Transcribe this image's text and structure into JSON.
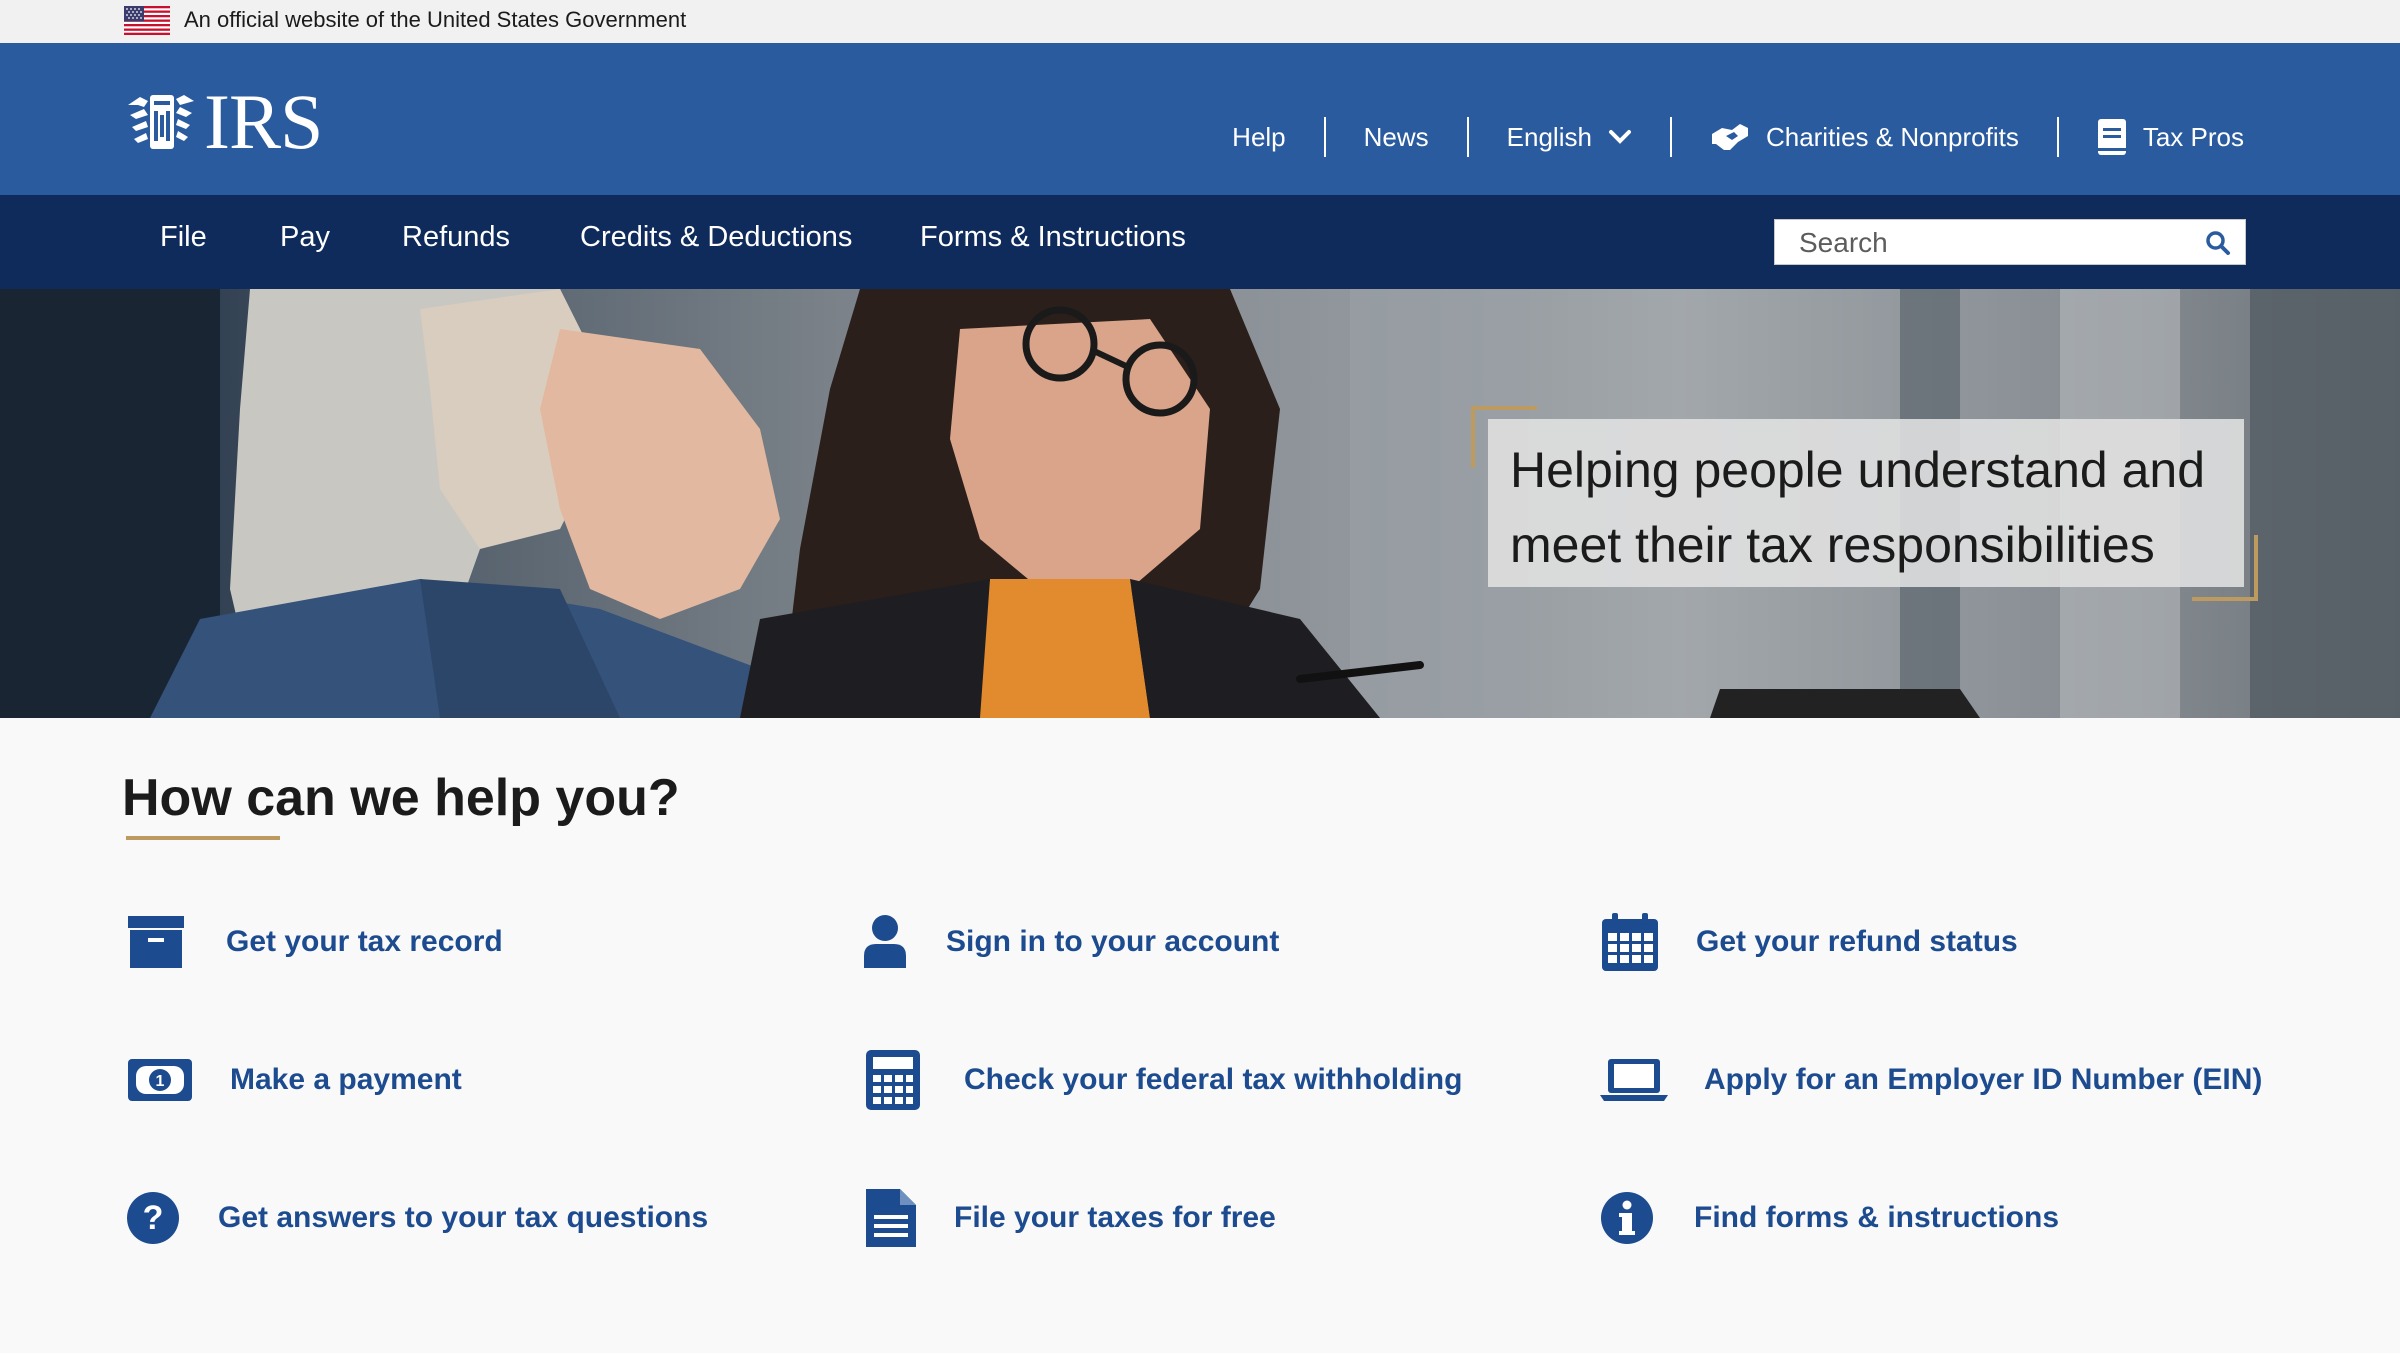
{
  "gov_banner": {
    "text": "An official website of the United States Government"
  },
  "logo": {
    "text": "IRS"
  },
  "utility_nav": {
    "help": "Help",
    "news": "News",
    "language": "English",
    "charities": "Charities & Nonprofits",
    "tax_pros": "Tax Pros"
  },
  "main_nav": {
    "items": [
      "File",
      "Pay",
      "Refunds",
      "Credits & Deductions",
      "Forms & Instructions"
    ]
  },
  "search": {
    "placeholder": "Search"
  },
  "hero": {
    "line1": "Helping people understand and",
    "line2": "meet their tax responsibilities"
  },
  "help": {
    "title": "How can we help you?",
    "links": [
      {
        "label": "Get your tax record",
        "icon": "archive-box-icon"
      },
      {
        "label": "Sign in to your account",
        "icon": "user-icon"
      },
      {
        "label": "Get your refund status",
        "icon": "calendar-icon"
      },
      {
        "label": "Make a payment",
        "icon": "dollar-bill-icon"
      },
      {
        "label": "Check your federal tax withholding",
        "icon": "calculator-icon"
      },
      {
        "label": "Apply for an Employer ID Number (EIN)",
        "icon": "laptop-icon"
      },
      {
        "label": "Get answers to your tax questions",
        "icon": "question-circle-icon"
      },
      {
        "label": "File your taxes for free",
        "icon": "document-icon"
      },
      {
        "label": "Find forms & instructions",
        "icon": "info-circle-icon"
      }
    ]
  },
  "colors": {
    "header_blue": "#2a5b9f",
    "nav_navy": "#0f2b5b",
    "link_blue": "#1d4b8f",
    "gold_accent": "#bd9a5f"
  }
}
